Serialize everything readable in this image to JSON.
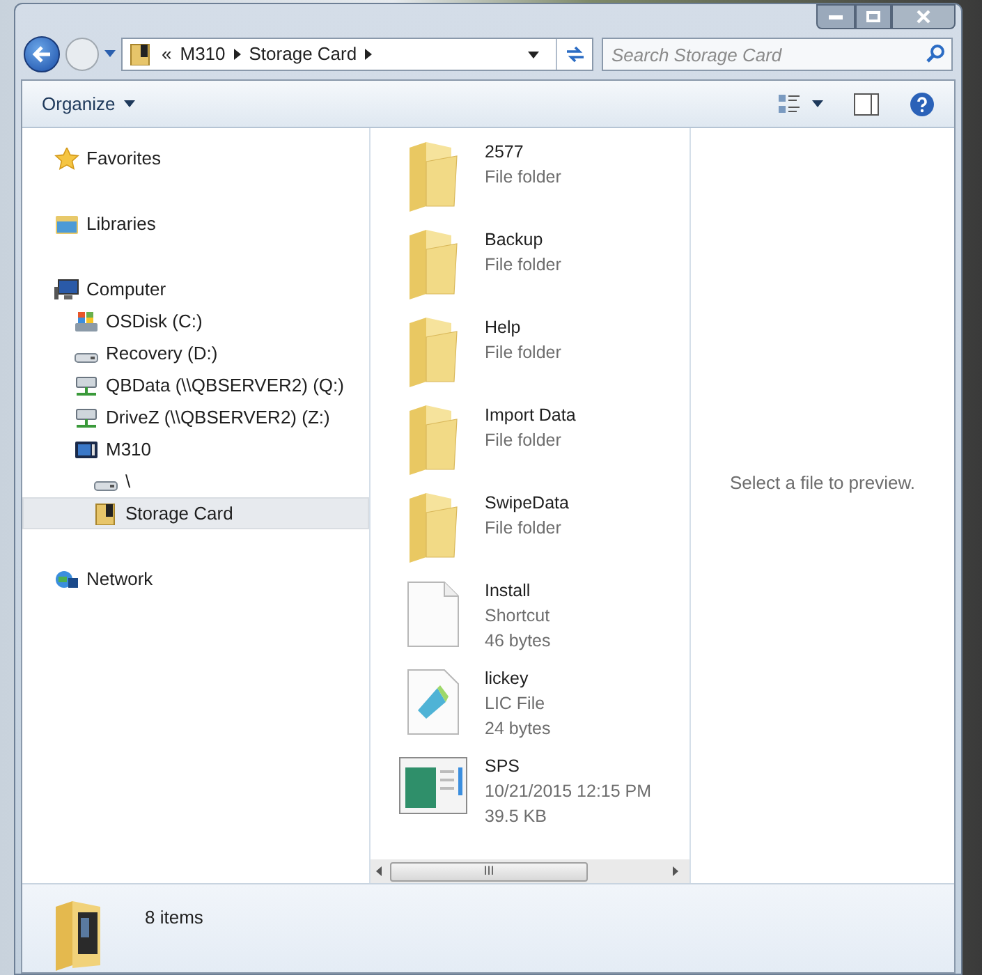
{
  "address_bar": {
    "overflow": "«",
    "crumbs": [
      "M310",
      "Storage Card"
    ]
  },
  "search": {
    "placeholder": "Search Storage Card"
  },
  "toolbar": {
    "organize": "Organize"
  },
  "nav_tree": [
    {
      "label": "Favorites",
      "kind": "star",
      "selected": false
    },
    {
      "label": "Libraries",
      "kind": "library",
      "selected": false
    },
    {
      "label": "Computer",
      "kind": "computer",
      "selected": false,
      "children": [
        {
          "label": "OSDisk (C:)",
          "kind": "osdisk",
          "selected": false
        },
        {
          "label": "Recovery (D:)",
          "kind": "drive",
          "selected": false
        },
        {
          "label": "QBData (\\\\QBSERVER2) (Q:)",
          "kind": "netdrive",
          "selected": false
        },
        {
          "label": "DriveZ (\\\\QBSERVER2) (Z:)",
          "kind": "netdrive",
          "selected": false
        },
        {
          "label": "M310",
          "kind": "device",
          "selected": false,
          "children": [
            {
              "label": "\\",
              "kind": "drive",
              "selected": false
            },
            {
              "label": "Storage Card",
              "kind": "card",
              "selected": true
            }
          ]
        }
      ]
    },
    {
      "label": "Network",
      "kind": "network",
      "selected": false
    }
  ],
  "files": [
    {
      "name": "2577",
      "kind": "folder",
      "details": [
        "File folder"
      ]
    },
    {
      "name": "Backup",
      "kind": "folder",
      "details": [
        "File folder"
      ]
    },
    {
      "name": "Help",
      "kind": "folder",
      "details": [
        "File folder"
      ]
    },
    {
      "name": "Import Data",
      "kind": "folder",
      "details": [
        "File folder"
      ]
    },
    {
      "name": "SwipeData",
      "kind": "folder",
      "details": [
        "File folder"
      ]
    },
    {
      "name": "Install",
      "kind": "shortcut",
      "details": [
        "Shortcut",
        "46 bytes"
      ]
    },
    {
      "name": "lickey",
      "kind": "document",
      "details": [
        "LIC File",
        "24 bytes"
      ]
    },
    {
      "name": "SPS",
      "kind": "application",
      "details": [
        "10/21/2015 12:15 PM",
        "39.5 KB"
      ]
    }
  ],
  "scrollbar_grip": "III",
  "preview": {
    "message": "Select a file to preview."
  },
  "details_pane": {
    "count": "8 items"
  }
}
